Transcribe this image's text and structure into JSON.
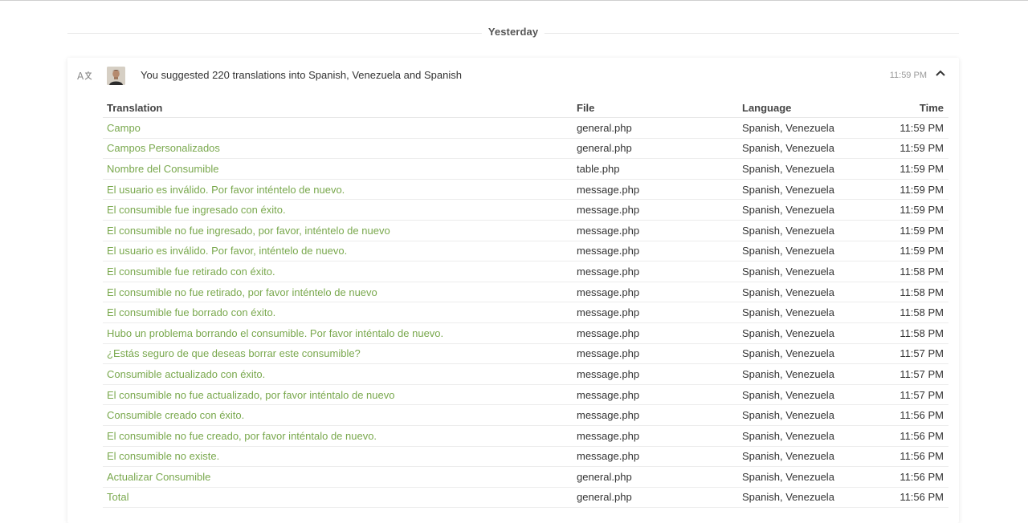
{
  "day_divider": {
    "label": "Yesterday"
  },
  "activity": {
    "summary": "You suggested 220 translations into Spanish, Venezuela and Spanish",
    "time": "11:59 PM",
    "icons": {
      "type": "translate-icon",
      "collapse": "chevron-up-icon"
    },
    "accent_color": "#79a84d"
  },
  "table": {
    "headers": {
      "translation": "Translation",
      "file": "File",
      "language": "Language",
      "time": "Time"
    },
    "rows": [
      {
        "translation": "Campo",
        "file": "general.php",
        "language": "Spanish, Venezuela",
        "time": "11:59 PM"
      },
      {
        "translation": "Campos Personalizados",
        "file": "general.php",
        "language": "Spanish, Venezuela",
        "time": "11:59 PM"
      },
      {
        "translation": "Nombre del Consumible",
        "file": "table.php",
        "language": "Spanish, Venezuela",
        "time": "11:59 PM"
      },
      {
        "translation": "El usuario es inválido. Por favor inténtelo de nuevo.",
        "file": "message.php",
        "language": "Spanish, Venezuela",
        "time": "11:59 PM"
      },
      {
        "translation": "El consumible fue ingresado con éxito.",
        "file": "message.php",
        "language": "Spanish, Venezuela",
        "time": "11:59 PM"
      },
      {
        "translation": "El consumible no fue ingresado, por favor, inténtelo de nuevo",
        "file": "message.php",
        "language": "Spanish, Venezuela",
        "time": "11:59 PM"
      },
      {
        "translation": "El usuario es inválido. Por favor, inténtelo de nuevo.",
        "file": "message.php",
        "language": "Spanish, Venezuela",
        "time": "11:59 PM"
      },
      {
        "translation": "El consumible fue retirado con éxito.",
        "file": "message.php",
        "language": "Spanish, Venezuela",
        "time": "11:58 PM"
      },
      {
        "translation": "El consumible no fue retirado, por favor inténtelo de nuevo",
        "file": "message.php",
        "language": "Spanish, Venezuela",
        "time": "11:58 PM"
      },
      {
        "translation": "El consumible fue borrado con éxito.",
        "file": "message.php",
        "language": "Spanish, Venezuela",
        "time": "11:58 PM"
      },
      {
        "translation": "Hubo un problema borrando el consumible. Por favor inténtalo de nuevo.",
        "file": "message.php",
        "language": "Spanish, Venezuela",
        "time": "11:58 PM"
      },
      {
        "translation": "¿Estás seguro de que deseas borrar este consumible?",
        "file": "message.php",
        "language": "Spanish, Venezuela",
        "time": "11:57 PM"
      },
      {
        "translation": "Consumible actualizado con éxito.",
        "file": "message.php",
        "language": "Spanish, Venezuela",
        "time": "11:57 PM"
      },
      {
        "translation": "El consumible no fue actualizado, por favor inténtalo de nuevo",
        "file": "message.php",
        "language": "Spanish, Venezuela",
        "time": "11:57 PM"
      },
      {
        "translation": "Consumible creado con éxito.",
        "file": "message.php",
        "language": "Spanish, Venezuela",
        "time": "11:56 PM"
      },
      {
        "translation": "El consumible no fue creado, por favor inténtalo de nuevo.",
        "file": "message.php",
        "language": "Spanish, Venezuela",
        "time": "11:56 PM"
      },
      {
        "translation": "El consumible no existe.",
        "file": "message.php",
        "language": "Spanish, Venezuela",
        "time": "11:56 PM"
      },
      {
        "translation": "Actualizar Consumible",
        "file": "general.php",
        "language": "Spanish, Venezuela",
        "time": "11:56 PM"
      },
      {
        "translation": "Total",
        "file": "general.php",
        "language": "Spanish, Venezuela",
        "time": "11:56 PM"
      }
    ]
  }
}
